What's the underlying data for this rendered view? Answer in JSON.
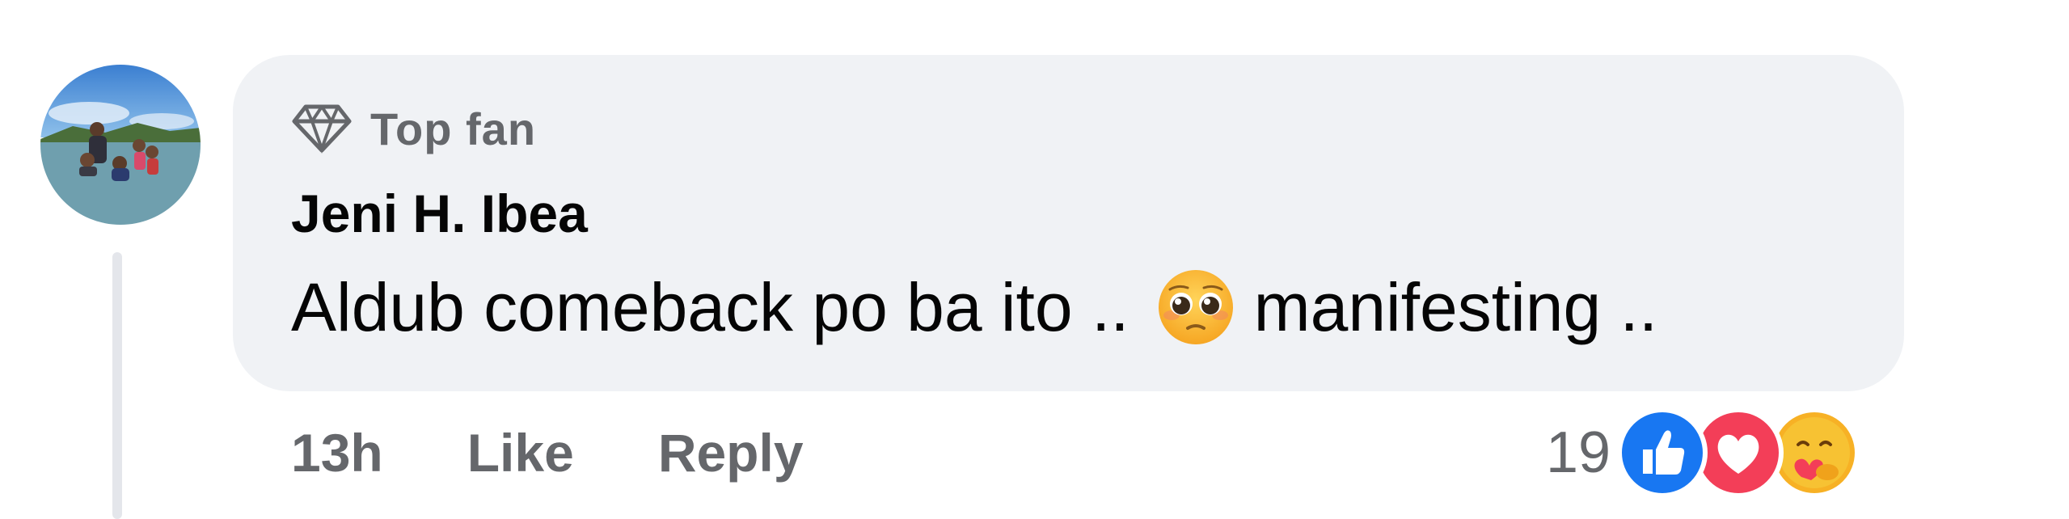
{
  "comment": {
    "badge": "Top fan",
    "author": "Jeni H. Ibea",
    "text_before_emoji": "Aldub comeback po ba ito ..",
    "emoji": "pleading-face-emoji",
    "text_after_emoji": "manifesting ..",
    "time": "13h",
    "like_label": "Like",
    "reply_label": "Reply",
    "reaction_count": "19",
    "reactions": [
      "like-icon",
      "love-icon",
      "care-icon"
    ]
  },
  "colors": {
    "bubble": "#f0f2f5",
    "secondary_text": "#65676b",
    "primary_text": "#050505",
    "like": "#1877f2",
    "love": "#f33e58",
    "care": "#f7b125"
  }
}
